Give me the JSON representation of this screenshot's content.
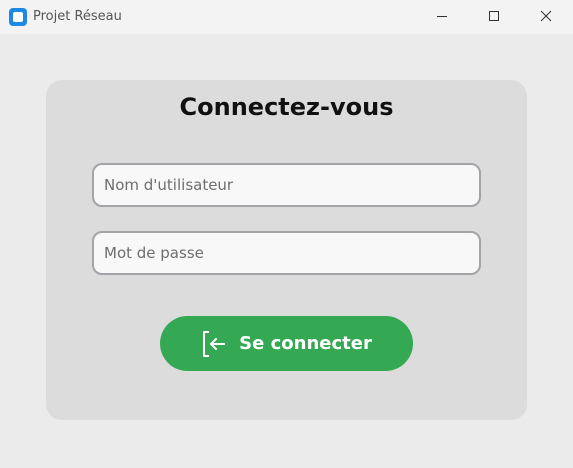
{
  "window": {
    "title": "Projet Réseau",
    "app_icon": "app-logo-icon",
    "controls": {
      "minimize_icon": "minimize-icon",
      "maximize_icon": "maximize-icon",
      "close_icon": "close-icon"
    }
  },
  "login": {
    "heading": "Connectez-vous",
    "username": {
      "value": "",
      "placeholder": "Nom d'utilisateur"
    },
    "password": {
      "value": "",
      "placeholder": "Mot de passe"
    },
    "submit": {
      "label": "Se connecter",
      "icon": "login-arrow-icon"
    }
  },
  "colors": {
    "accent_button": "#34a853",
    "card_background": "#dcdcdc",
    "window_background": "#ebebeb",
    "app_icon": "#1e88e5"
  }
}
